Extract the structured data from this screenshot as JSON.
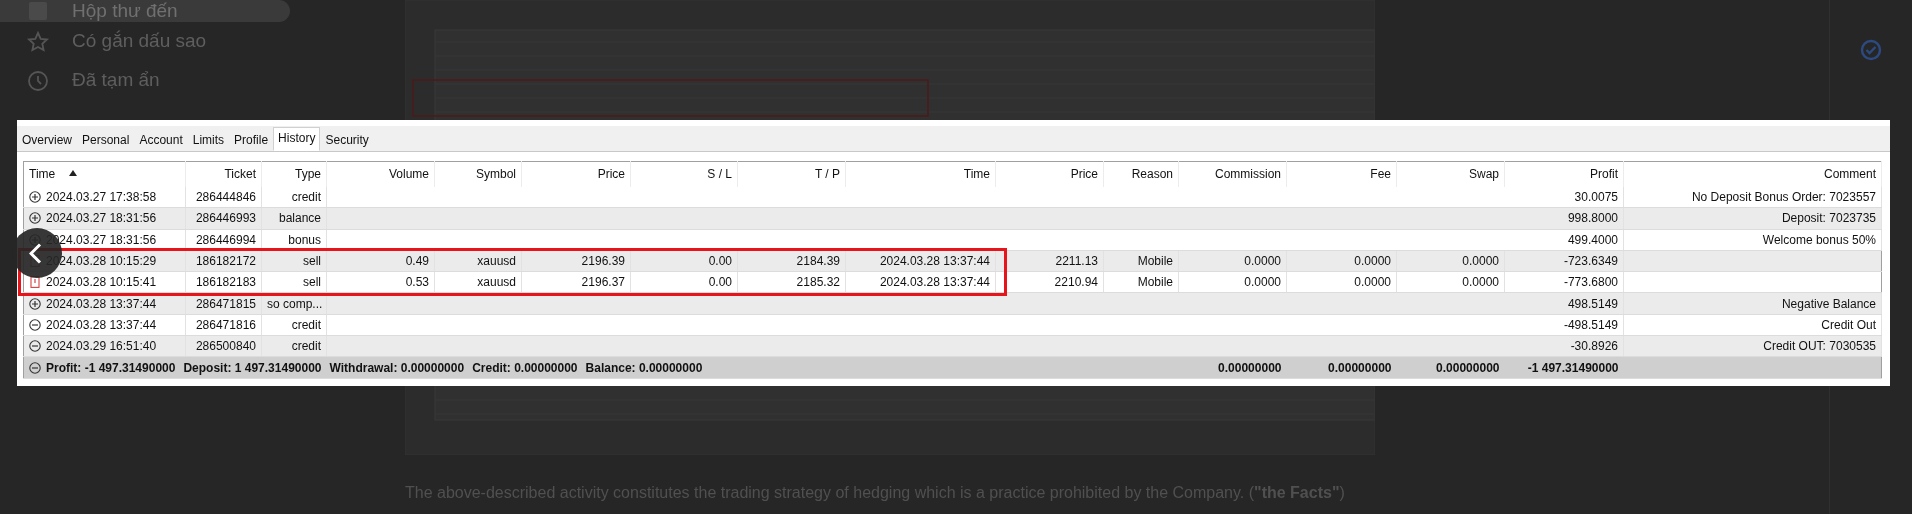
{
  "sidebar": {
    "items": [
      {
        "label": "Hộp thư đến",
        "kind": "inbox",
        "selected": true
      },
      {
        "label": "Có gắn dấu sao",
        "kind": "star",
        "selected": false
      },
      {
        "label": "Đã tạm ẩn",
        "kind": "clock",
        "selected": false
      }
    ]
  },
  "email_body": {
    "text": "The above-described activity constitutes the trading strategy of hedging which is a practice prohibited by the Company. (**\"the Facts\"**)"
  },
  "viewer": {
    "tabs": [
      {
        "label": "Overview",
        "selected": false
      },
      {
        "label": "Personal",
        "selected": false
      },
      {
        "label": "Account",
        "selected": false
      },
      {
        "label": "Limits",
        "selected": false
      },
      {
        "label": "Profile",
        "selected": false
      },
      {
        "label": "History",
        "selected": true
      },
      {
        "label": "Security",
        "selected": false
      }
    ],
    "table": {
      "columns": [
        {
          "label": "Time",
          "sorted": true
        },
        {
          "label": "Ticket",
          "sorted": false
        },
        {
          "label": "Type",
          "sorted": false
        },
        {
          "label": "Volume",
          "sorted": false
        },
        {
          "label": "Symbol",
          "sorted": false
        },
        {
          "label": "Price",
          "sorted": false
        },
        {
          "label": "S / L",
          "sorted": false
        },
        {
          "label": "T / P",
          "sorted": false
        },
        {
          "label": "Time",
          "sorted": false
        },
        {
          "label": "Price",
          "sorted": false
        },
        {
          "label": "Reason",
          "sorted": false
        },
        {
          "label": "Commission",
          "sorted": false
        },
        {
          "label": "Fee",
          "sorted": false
        },
        {
          "label": "Swap",
          "sorted": false
        },
        {
          "label": "Profit",
          "sorted": false
        },
        {
          "label": "Comment",
          "sorted": false
        }
      ],
      "rows": [
        {
          "kind": "plus",
          "time": "2024.03.27 17:38:58",
          "ticket": "286444846",
          "type": "credit",
          "profit": "30.0075",
          "comment": "No Deposit Bonus Order: 7023557"
        },
        {
          "kind": "plus",
          "time": "2024.03.27 18:31:56",
          "ticket": "286446993",
          "type": "balance",
          "profit": "998.8000",
          "comment": "Deposit: 7023735"
        },
        {
          "kind": "plus",
          "time": "2024.03.27 18:31:56",
          "ticket": "286446994",
          "type": "bonus",
          "profit": "499.4000",
          "comment": "Welcome bonus 50%"
        },
        {
          "kind": "sell",
          "time": "2024.03.28 10:15:29",
          "ticket": "186182172",
          "type": "sell",
          "volume": "0.49",
          "symbol": "xauusd",
          "price": "2196.39",
          "sl": "0.00",
          "tp": "2184.39",
          "close_time": "2024.03.28 13:37:44",
          "close_price": "2211.13",
          "reason": "Mobile",
          "commission": "0.0000",
          "fee": "0.0000",
          "swap": "0.0000",
          "profit": "-723.6349"
        },
        {
          "kind": "sell",
          "time": "2024.03.28 10:15:41",
          "ticket": "186182183",
          "type": "sell",
          "volume": "0.53",
          "symbol": "xauusd",
          "price": "2196.37",
          "sl": "0.00",
          "tp": "2185.32",
          "close_time": "2024.03.28 13:37:44",
          "close_price": "2210.94",
          "reason": "Mobile",
          "commission": "0.0000",
          "fee": "0.0000",
          "swap": "0.0000",
          "profit": "-773.6800"
        },
        {
          "kind": "plus",
          "time": "2024.03.28 13:37:44",
          "ticket": "286471815",
          "type": "so comp...",
          "profit": "498.5149",
          "comment": "Negative Balance"
        },
        {
          "kind": "minus",
          "time": "2024.03.28 13:37:44",
          "ticket": "286471816",
          "type": "credit",
          "profit": "-498.5149",
          "comment": "Credit Out"
        },
        {
          "kind": "minus",
          "time": "2024.03.29 16:51:40",
          "ticket": "286500840",
          "type": "credit",
          "profit": "-30.8926",
          "comment": "Credit OUT: 7030535"
        }
      ],
      "totals": {
        "kind": "minus",
        "summary": [
          "Profit: -1 497.31490000",
          "Deposit: 1 497.31490000",
          "Withdrawal: 0.00000000",
          "Credit: 0.00000000",
          "Balance: 0.00000000"
        ],
        "commission": "0.00000000",
        "fee": "0.00000000",
        "swap": "0.00000000",
        "profit": "-1 497.31490000"
      }
    }
  }
}
